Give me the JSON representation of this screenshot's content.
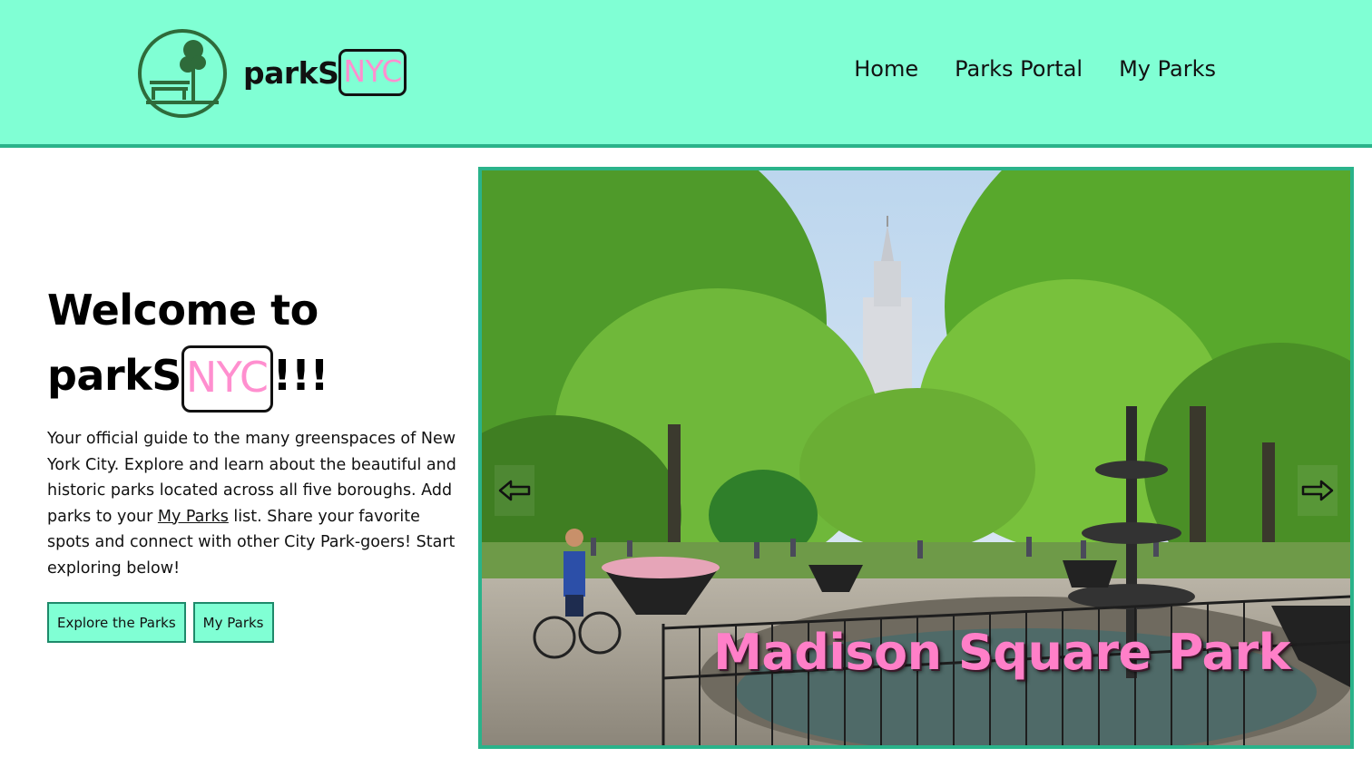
{
  "brand": {
    "prefix": "parkS",
    "suffix": "NYC"
  },
  "nav": {
    "home": "Home",
    "parks_portal": "Parks Portal",
    "my_parks": "My Parks"
  },
  "hero": {
    "welcome_line1": "Welcome to",
    "welcome_prefix": "parkS",
    "welcome_suffix": "NYC",
    "welcome_exclaim": "!!!",
    "intro_part1": "Your official guide to the many greenspaces of New York City. Explore and learn about the beautiful and historic parks located across all five boroughs. Add parks to your ",
    "intro_link": "My Parks",
    "intro_part2": " list. Share your favorite spots and connect with other City Park-goers! Start exploring below!",
    "explore_button": "Explore the Parks",
    "my_parks_button": "My Parks"
  },
  "slideshow": {
    "caption": "Madison Square Park",
    "prev_icon": "arrow-left-icon",
    "next_icon": "arrow-right-icon"
  },
  "colors": {
    "header_bg": "#80ffd4",
    "accent_border": "#2ab38a",
    "nyc_pink": "#ff8fcf",
    "logo_green": "#2e6b3a"
  }
}
